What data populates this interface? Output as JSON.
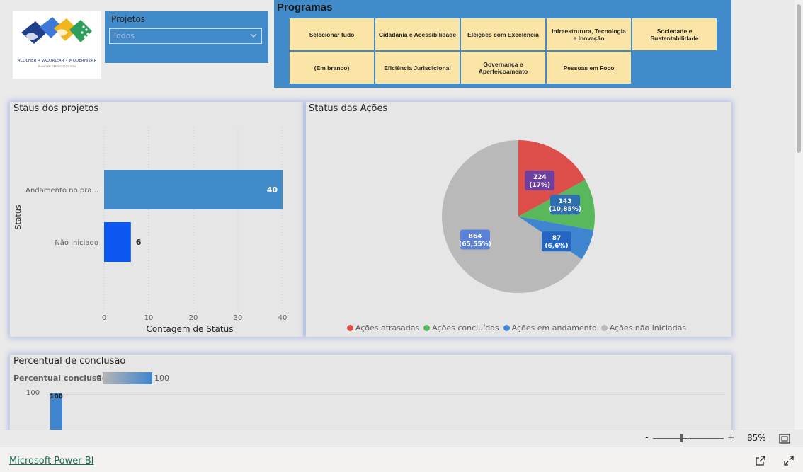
{
  "logo": {
    "caption": "ACOLHER • VALORIZAR • MODERNIZAR",
    "subcaption": "PLANO DE GESTÃO 2023-2024"
  },
  "projetos_slicer": {
    "title": "Projetos",
    "selected": "Todos"
  },
  "programas": {
    "title": "Programas",
    "items": [
      "Selecionar tudo",
      "Cidadania e Acessibilidade",
      "Eleições com Excelência",
      "Infraestrurura, Tecnologia e Inovação",
      "Sociedade e Sustentabilidade",
      "(Em branco)",
      "Eficiência Jurisdicional",
      "Governança e Aperfeiçoamento",
      "Pessoas em Foco"
    ]
  },
  "status_projetos": {
    "title": "Staus dos projetos",
    "chart_data": {
      "type": "bar",
      "orientation": "horizontal",
      "categories": [
        "Andamento no pra...",
        "Não iniciado"
      ],
      "values": [
        40,
        6
      ],
      "colors": [
        "#428bca",
        "#0b57f0"
      ],
      "xlabel": "Contagem de Status",
      "ylabel": "Status",
      "xlim": [
        0,
        40
      ],
      "xticks": [
        0,
        10,
        20,
        30,
        40
      ]
    }
  },
  "status_acoes": {
    "title": "Status das Ações",
    "chart_data": {
      "type": "pie",
      "slices": [
        {
          "label": "Ações atrasadas",
          "value": 224,
          "percent": "17%",
          "color": "#dd4e4b"
        },
        {
          "label": "Ações concluídas",
          "value": 143,
          "percent": "10,85%",
          "color": "#58b85b"
        },
        {
          "label": "Ações em andamento",
          "value": 87,
          "percent": "6,6%",
          "color": "#3f85cf"
        },
        {
          "label": "Ações não iniciadas",
          "value": 864,
          "percent": "65,55%",
          "color": "#b9b9b9"
        }
      ],
      "legend": "bottom"
    }
  },
  "percentual": {
    "title": "Percentual de conclusão",
    "gradient_label": "Percentual conclusão",
    "gradient_min": "0",
    "gradient_max": "100",
    "chart_data": {
      "type": "bar",
      "values": [
        100
      ],
      "ytick": "100",
      "bar_color": "#3f85cf"
    }
  },
  "zoom": {
    "minus": "-",
    "plus": "+",
    "level": "85%",
    "fraction": 0.5
  },
  "footer": {
    "link": "Microsoft Power BI"
  }
}
